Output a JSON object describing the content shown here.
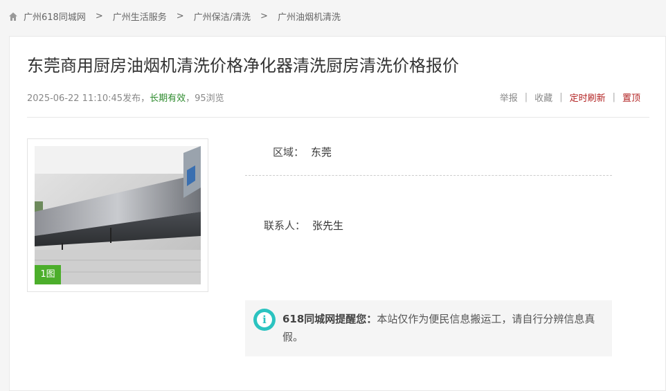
{
  "breadcrumb": {
    "items": [
      "广州618同城网",
      "广州生活服务",
      "广州保洁/清洗",
      "广州油烟机清洗"
    ],
    "separator": ">"
  },
  "post": {
    "title": "东莞商用厨房油烟机清洗价格净化器清洗厨房清洗价格报价",
    "date": "2025-06-22 11:10:45发布，",
    "validity": "长期有效",
    "views": "，95浏览"
  },
  "actions": {
    "report": "举报",
    "favorite": "收藏",
    "refresh": "定时刷新",
    "pin": "置顶",
    "separator": "|"
  },
  "photo": {
    "badge": "1图"
  },
  "details": {
    "region_label": "区域：",
    "region_value": "东莞",
    "contact_label": "联系人：",
    "contact_value": "张先生"
  },
  "notice": {
    "icon": "info-icon",
    "bold": "618同城网提醒您：",
    "text": "本站仅作为便民信息搬运工，请自行分辨信息真假。"
  },
  "colors": {
    "green_badge": "#4cae2b",
    "validity_green": "#2e8b2e",
    "action_red": "#b22222",
    "info_teal": "#2bc3c0"
  }
}
